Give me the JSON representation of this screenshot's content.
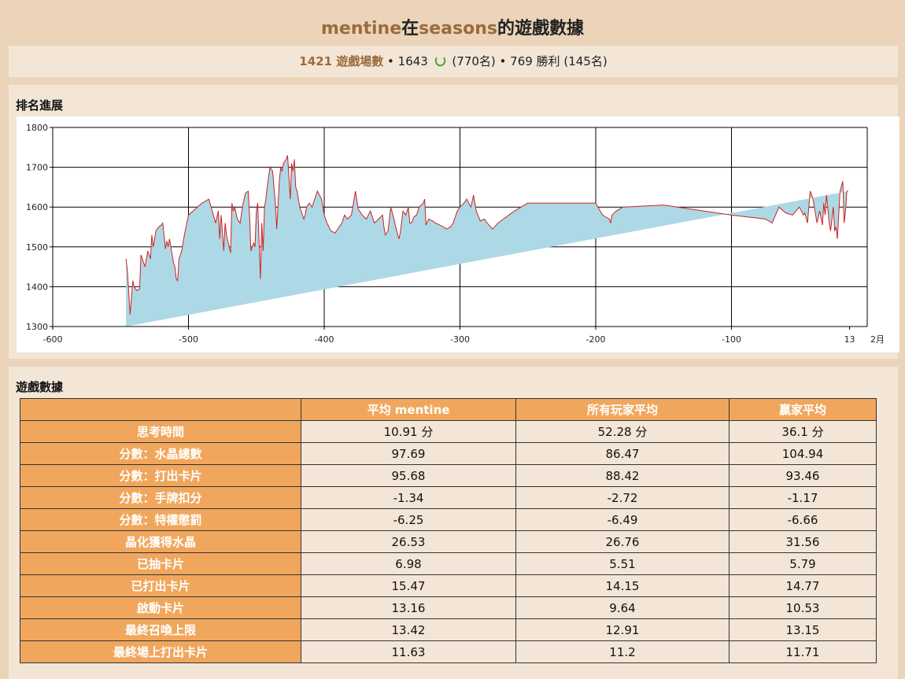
{
  "header": {
    "player": "mentine",
    "connector": "在",
    "game": "seasons",
    "suffix": "的遊戲數據"
  },
  "summary": {
    "games_count": "1421 遊戲場數",
    "sep1": " • ",
    "elo": "1643",
    "elo_rank": "(770名)",
    "sep2": " • ",
    "wins": "769 勝利",
    "wins_rank": "(145名)"
  },
  "rank_panel": {
    "title": "排名進展"
  },
  "chart_data": {
    "type": "area",
    "xlim": [
      -600,
      0
    ],
    "ylim": [
      1300,
      1800
    ],
    "x_ticks": [
      "-600",
      "-500",
      "-400",
      "-300",
      "-200",
      "-100",
      "13"
    ],
    "x_ticks_values": [
      -600,
      -500,
      -400,
      -300,
      -200,
      -100,
      -13
    ],
    "x_end_label": "2月",
    "y_ticks": [
      1300,
      1400,
      1500,
      1600,
      1700,
      1800
    ],
    "grid": true,
    "colors": {
      "fill": "#add8e6",
      "line": "#cc2222"
    },
    "x": [
      -546,
      -545,
      -543,
      -541,
      -540,
      -538,
      -536,
      -535,
      -534,
      -532,
      -530,
      -528,
      -527,
      -526,
      -524,
      -523,
      -522,
      -520,
      -519,
      -518,
      -517,
      -516,
      -515,
      -514,
      -512,
      -511,
      -510,
      -509,
      -508,
      -507,
      -505,
      -503,
      -500,
      -495,
      -490,
      -485,
      -480,
      -478,
      -477,
      -476,
      -474,
      -473,
      -472,
      -470,
      -469,
      -468,
      -467,
      -466,
      -464,
      -462,
      -460,
      -459,
      -458,
      -456,
      -455,
      -454,
      -452,
      -451,
      -450,
      -449,
      -447,
      -446,
      -445,
      -444,
      -443,
      -442,
      -440,
      -438,
      -436,
      -435,
      -433,
      -432,
      -431,
      -430,
      -428,
      -427,
      -425,
      -424,
      -423,
      -422,
      -421,
      -420,
      -419,
      -418,
      -417,
      -416,
      -415,
      -414,
      -413,
      -411,
      -409,
      -407,
      -405,
      -402,
      -400,
      -398,
      -395,
      -392,
      -390,
      -387,
      -385,
      -383,
      -380,
      -377,
      -375,
      -372,
      -369,
      -366,
      -363,
      -360,
      -357,
      -356,
      -355,
      -353,
      -351,
      -349,
      -348,
      -347,
      -345,
      -344,
      -342,
      -340,
      -338,
      -337,
      -336,
      -335,
      -334,
      -332,
      -330,
      -327,
      -326,
      -325,
      -323,
      -320,
      -318,
      -315,
      -312,
      -310,
      -307,
      -305,
      -302,
      -300,
      -297,
      -295,
      -292,
      -290,
      -288,
      -285,
      -282,
      -280,
      -276,
      -272,
      -268,
      -264,
      -260,
      -255,
      -250,
      -200,
      -195,
      -190,
      -189,
      -188,
      -185,
      -180,
      -150,
      -100,
      -75,
      -70,
      -65,
      -60,
      -55,
      -50,
      -47,
      -46,
      -44,
      -43,
      -42,
      -40,
      -39,
      -38,
      -37,
      -35,
      -33,
      -32,
      -31,
      -30,
      -28,
      -27,
      -25,
      -24,
      -23,
      -22,
      -20,
      -18,
      -17,
      -16,
      -15,
      -14,
      -13
    ],
    "y": [
      1470,
      1440,
      1330,
      1415,
      1400,
      1390,
      1395,
      1480,
      1470,
      1450,
      1490,
      1470,
      1530,
      1500,
      1540,
      1545,
      1550,
      1555,
      1560,
      1530,
      1495,
      1515,
      1500,
      1520,
      1480,
      1460,
      1450,
      1420,
      1415,
      1470,
      1490,
      1530,
      1580,
      1595,
      1610,
      1620,
      1560,
      1590,
      1520,
      1580,
      1490,
      1560,
      1530,
      1500,
      1485,
      1610,
      1590,
      1600,
      1570,
      1560,
      1605,
      1620,
      1635,
      1640,
      1580,
      1490,
      1510,
      1500,
      1590,
      1610,
      1420,
      1560,
      1490,
      1600,
      1620,
      1650,
      1700,
      1690,
      1610,
      1545,
      1670,
      1700,
      1690,
      1710,
      1720,
      1730,
      1620,
      1710,
      1690,
      1720,
      1650,
      1640,
      1620,
      1600,
      1590,
      1580,
      1570,
      1580,
      1600,
      1610,
      1600,
      1620,
      1640,
      1620,
      1580,
      1560,
      1540,
      1535,
      1545,
      1560,
      1580,
      1570,
      1580,
      1640,
      1595,
      1580,
      1570,
      1590,
      1560,
      1570,
      1580,
      1550,
      1530,
      1540,
      1600,
      1575,
      1560,
      1545,
      1520,
      1535,
      1590,
      1580,
      1600,
      1560,
      1560,
      1565,
      1575,
      1580,
      1600,
      1610,
      1620,
      1555,
      1570,
      1565,
      1560,
      1555,
      1550,
      1545,
      1550,
      1560,
      1590,
      1600,
      1610,
      1620,
      1600,
      1630,
      1590,
      1565,
      1570,
      1560,
      1545,
      1560,
      1570,
      1580,
      1590,
      1600,
      1610,
      1610,
      1580,
      1570,
      1560,
      1580,
      1590,
      1600,
      1605,
      1580,
      1570,
      1560,
      1600,
      1585,
      1580,
      1600,
      1580,
      1585,
      1560,
      1600,
      1640,
      1620,
      1600,
      1580,
      1560,
      1590,
      1555,
      1610,
      1580,
      1630,
      1560,
      1540,
      1600,
      1540,
      1550,
      1520,
      1640,
      1665,
      1560,
      1590,
      1640,
      1640
    ]
  },
  "stats_panel": {
    "title": "遊戲數據",
    "columns": [
      "平均 mentine",
      "所有玩家平均",
      "贏家平均"
    ],
    "rows": [
      {
        "label": "思考時間",
        "values": [
          "10.91 分",
          "52.28 分",
          "36.1 分"
        ]
      },
      {
        "label": "分數：水晶總數",
        "values": [
          "97.69",
          "86.47",
          "104.94"
        ]
      },
      {
        "label": "分數：打出卡片",
        "values": [
          "95.68",
          "88.42",
          "93.46"
        ]
      },
      {
        "label": "分數：手牌扣分",
        "values": [
          "-1.34",
          "-2.72",
          "-1.17"
        ]
      },
      {
        "label": "分數：特權懲罰",
        "values": [
          "-6.25",
          "-6.49",
          "-6.66"
        ]
      },
      {
        "label": "晶化獲得水晶",
        "values": [
          "26.53",
          "26.76",
          "31.56"
        ]
      },
      {
        "label": "已抽卡片",
        "values": [
          "6.98",
          "5.51",
          "5.79"
        ]
      },
      {
        "label": "已打出卡片",
        "values": [
          "15.47",
          "14.15",
          "14.77"
        ]
      },
      {
        "label": "啟動卡片",
        "values": [
          "13.16",
          "9.64",
          "10.53"
        ]
      },
      {
        "label": "最終召喚上限",
        "values": [
          "13.42",
          "12.91",
          "13.15"
        ]
      },
      {
        "label": "最終場上打出卡片",
        "values": [
          "11.63",
          "11.2",
          "11.71"
        ]
      }
    ]
  }
}
